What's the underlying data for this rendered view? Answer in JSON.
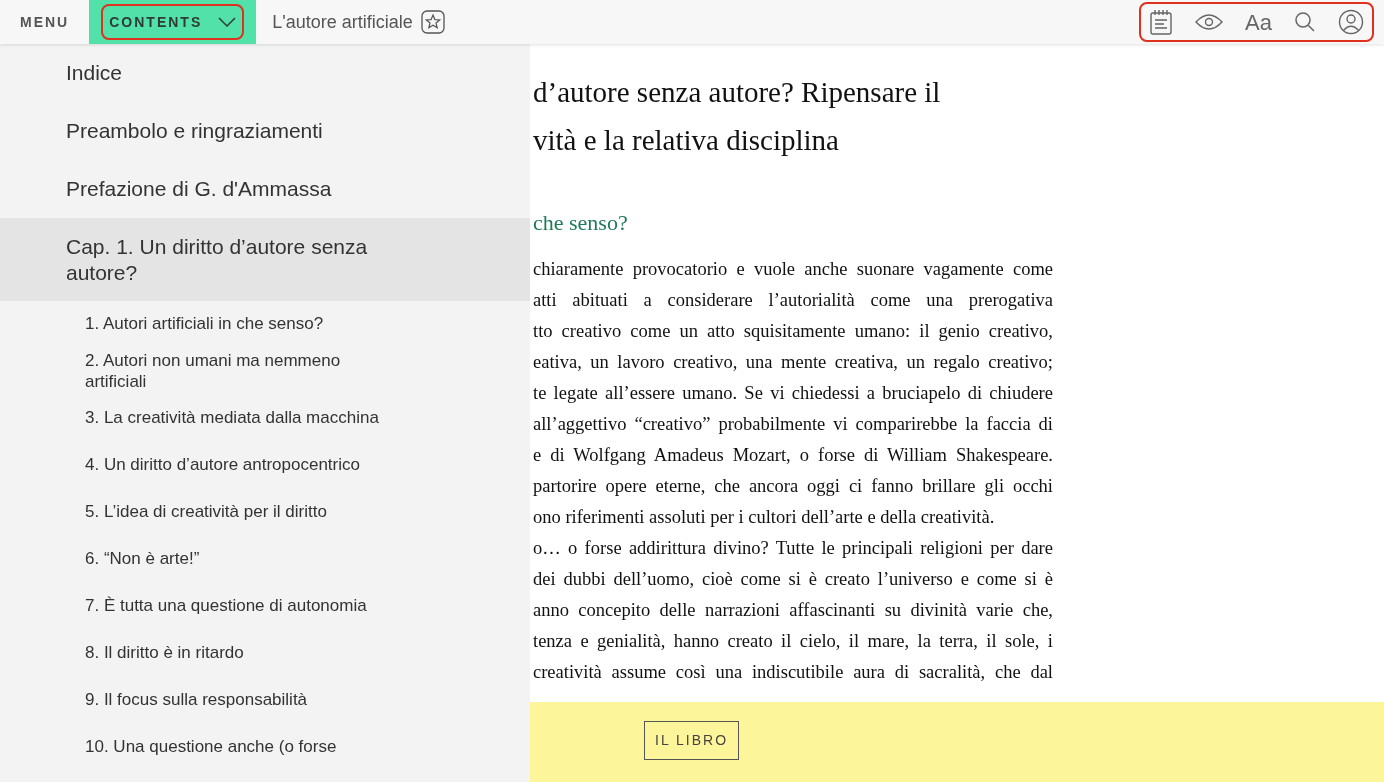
{
  "topbar": {
    "menu_label": "MENU",
    "contents_button": {
      "label": "CONTENTS",
      "expanded": true,
      "highlighted": true
    },
    "book_title": "L'autore artificiale",
    "toolbar_highlighted": true,
    "font_button": "Aa"
  },
  "toc": [
    {
      "label": "Indice",
      "selected": false
    },
    {
      "label": "Preambolo e ringraziamenti",
      "selected": false
    },
    {
      "label": "Prefazione di G. d'Ammassa",
      "selected": false
    },
    {
      "label": "Cap. 1. Un diritto d’autore senza autore?",
      "selected": true,
      "children": [
        {
          "label": "1. Autori artificiali in che senso?"
        },
        {
          "label": "2. Autori non umani ma nemmeno artificiali"
        },
        {
          "label": "3. La creatività mediata dalla macchina"
        },
        {
          "label": "4. Un diritto d’autore antropocentrico"
        },
        {
          "label": "5. L’idea di creatività per il diritto"
        },
        {
          "label": "6. “Non è arte!”"
        },
        {
          "label": "7. È tutta una questione di autonomia"
        },
        {
          "label": "8. Il diritto è in ritardo"
        },
        {
          "label": "9. Il focus sulla responsabilità"
        },
        {
          "label": "10. Una questione anche (o forse"
        }
      ]
    }
  ],
  "article": {
    "title_lines": [
      "d’autore senza autore? Ripensare il",
      "vità e la relativa disciplina"
    ],
    "section_heading": "che senso?",
    "lines": [
      {
        "text": "chiaramente provocatorio e vuole anche suonare vagamente come",
        "justified": true
      },
      {
        "text": "atti abituati a considerare l’autorialità come una prerogativa",
        "justified": true
      },
      {
        "text": "tto creativo come un atto squisitamente umano: il genio creativo,",
        "justified": true
      },
      {
        "text": "eativa, un lavoro creativo, una mente creativa, un regalo creativo;",
        "justified": true
      },
      {
        "text": "te legate all’essere umano. Se vi chiedessi a bruciapelo di chiudere",
        "justified": true
      },
      {
        "text": "all’aggettivo “creativo” probabilmente vi comparirebbe la faccia di",
        "justified": true
      },
      {
        "text": "e di Wolfgang Amadeus Mozart, o forse di William Shakespeare.",
        "justified": true
      },
      {
        "text": "partorire opere eterne, che ancora oggi ci fanno brillare gli occhi",
        "justified": true
      },
      {
        "text": "ono riferimenti assoluti per i cultori dell’arte e della creatività.",
        "justified": false
      },
      {
        "text": "o… o forse addirittura divino? Tutte le principali religioni per dare",
        "justified": true
      },
      {
        "text": "dei dubbi dell’uomo, cioè come si è creato l’universo e come si è",
        "justified": true
      },
      {
        "text": "anno concepito delle narrazioni affascinanti su divinità varie che,",
        "justified": true
      },
      {
        "text": "tenza e genialità, hanno creato il cielo, il mare, la terra, il sole, i",
        "justified": true
      },
      {
        "text": "creatività assume così una indiscutibile aura di sacralità, che dal",
        "justified": true
      }
    ]
  },
  "footer": {
    "button": "IL LIBRO"
  }
}
